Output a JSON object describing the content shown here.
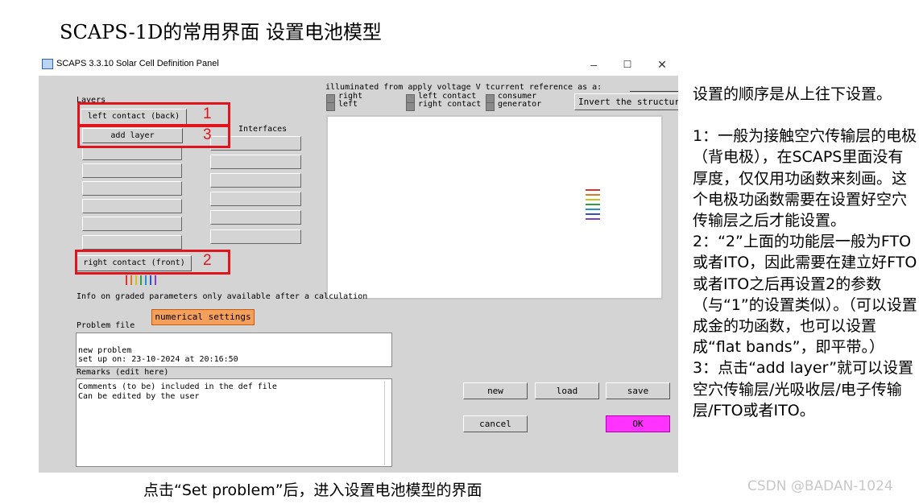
{
  "slide": {
    "title": "SCAPS-1D的常用界面 设置电池模型",
    "caption": "点击“Set problem”后，进入设置电池模型的界面",
    "watermark": "CSDN @BADAN-1024",
    "notes": [
      "设置的顺序是从上往下设置。",
      "1：一般为接触空穴传输层的电极（背电极），在SCAPS里面没有厚度，仅仅用功函数来刻画。这个电极功函数需要在设置好空穴传输层之后才能设置。",
      "2：“2”上面的功能层一般为FTO或者ITO，因此需要在建立好FTO或者ITO之后再设置2的参数（与“1”的设置类似）。（可以设置成金的功函数，也可以设置成“flat bands”，即平带。）",
      "3：点击“add layer”就可以设置空穴传输层/光吸收层/电子传输层/FTO或者ITO。"
    ]
  },
  "window": {
    "title": "SCAPS 3.3.10 Solar Cell Definition Panel",
    "controls": {
      "minimize": "–",
      "maximize": "☐",
      "close": "✕"
    }
  },
  "panel": {
    "layers_label": "Layers",
    "left_contact": "left contact (back)",
    "add_layer": "add layer",
    "right_contact": "right contact (front)",
    "interfaces_label": "Interfaces",
    "annotation_numbers": [
      "1",
      "3",
      "2"
    ],
    "illumination_header": "illuminated from apply voltage V tcurrent reference as a:",
    "illum_options": [
      [
        "right",
        "left"
      ],
      [
        "left contact",
        "right contact"
      ],
      [
        "consumer",
        "generator"
      ]
    ],
    "invert_button": "Invert the structure",
    "graded_info": "Info on graded parameters only available after a calculation",
    "numerical_settings": "numerical settings",
    "problem_file_label": "Problem file",
    "problem_file_lines": [
      "new problem",
      "set up on: 23-10-2024 at 20:16:50"
    ],
    "remarks_label": "Remarks (edit here)",
    "remarks_lines": [
      "Comments (to be) included in the def file",
      "Can be edited by the user"
    ],
    "buttons": {
      "new": "new",
      "load": "load",
      "save": "save",
      "cancel": "cancel",
      "ok": "OK"
    }
  },
  "colors": {
    "annotation_red": "#e0141c",
    "ok_magenta": "#ff33ff",
    "numerical_orange": "#f5a05a",
    "panel_gray": "#d4d4d4",
    "arrow_colors": [
      "#e03030",
      "#e07a20",
      "#d0c020",
      "#30a040",
      "#2090d0",
      "#3050d0",
      "#8040c0"
    ]
  }
}
